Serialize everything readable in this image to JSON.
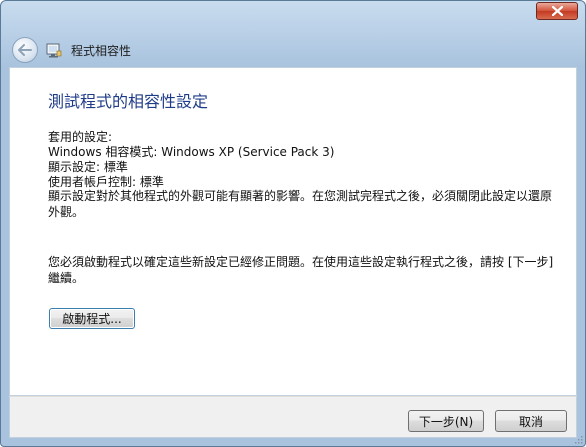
{
  "window": {
    "title": "程式相容性",
    "close_icon": "close-icon"
  },
  "nav": {
    "back_icon": "back-arrow-icon",
    "app_icon": "program-compatibility-icon"
  },
  "main": {
    "heading": "測試程式的相容性設定",
    "applied_label": "套用的設定:",
    "compat_mode": "Windows 相容模式: Windows XP (Service Pack 3)",
    "display_setting": "顯示設定: 標準",
    "uac_setting": "使用者帳戶控制: 標準",
    "display_note": "顯示設定對於其他程式的外觀可能有顯著的影響。在您測試完程式之後，必須關閉此設定以還原外觀。",
    "instruction": "您必須啟動程式以確定這些新設定已經修正問題。在使用這些設定執行程式之後，請按 [下一步] 繼續。",
    "launch_button": "啟動程式..."
  },
  "footer": {
    "next_button": "下一步(N)",
    "cancel_button": "取消"
  },
  "colors": {
    "heading": "#1f3c88",
    "close_button": "#c23a22",
    "frame": "#a9c3de"
  }
}
